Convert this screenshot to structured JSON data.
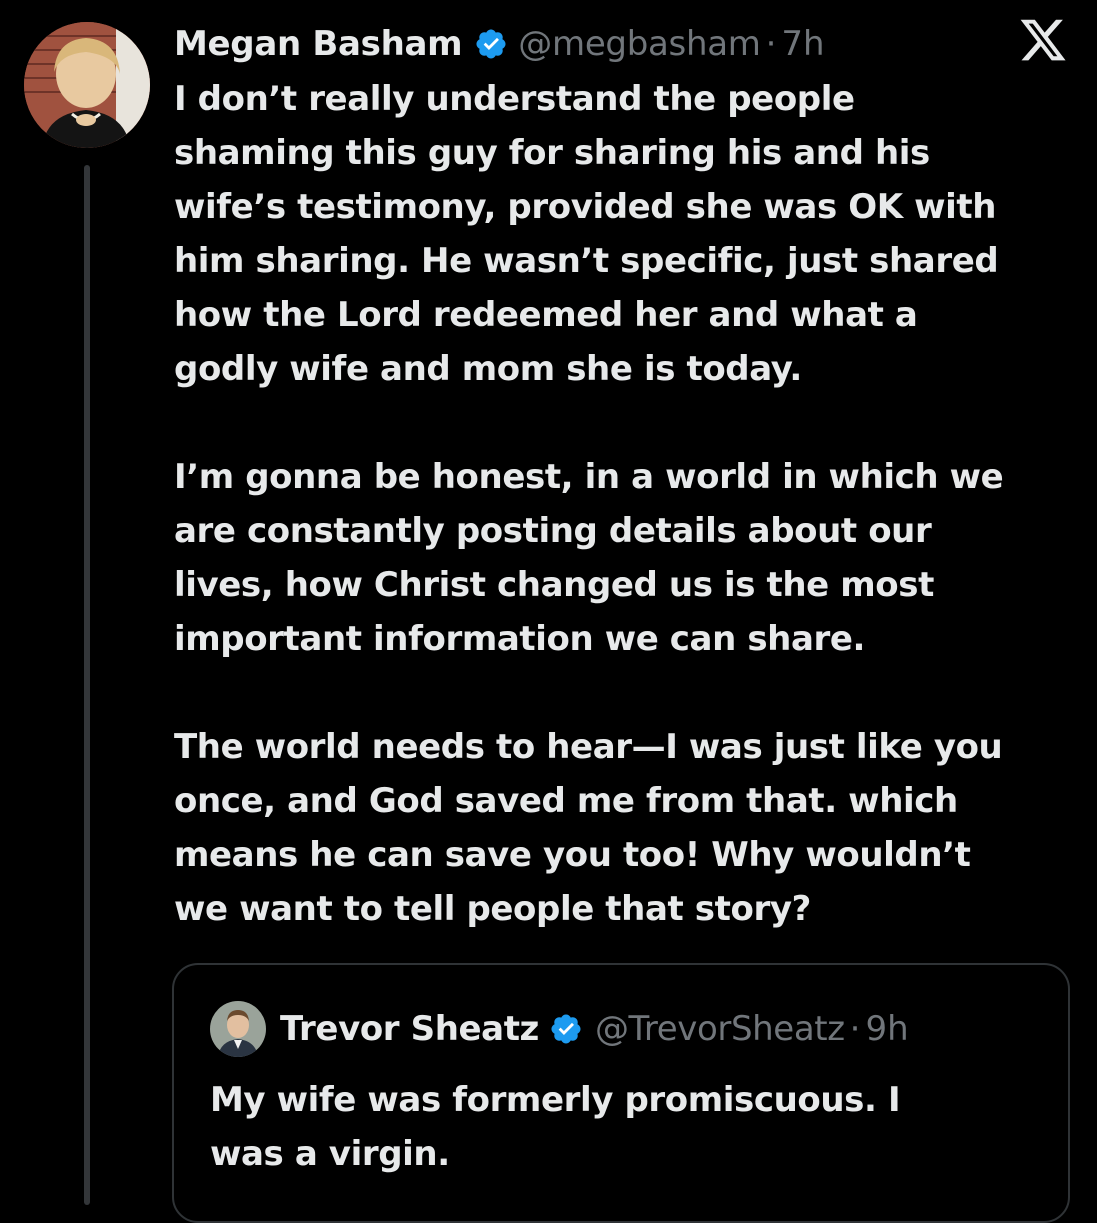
{
  "tweet": {
    "author_name": "Megan Basham",
    "handle": "@megbasham",
    "separator": "·",
    "time": "7h",
    "verified_icon": "verified-badge-icon",
    "paragraphs": [
      "I don’t really understand the people\nshaming this guy for sharing his and his\nwife’s testimony, provided she was OK with\nhim sharing. He wasn’t specific, just shared\nhow the Lord redeemed her and what a\ngodly wife and mom she is today.",
      "I’m gonna be honest, in a world in which we\nare constantly posting details about our\nlives, how Christ changed us is the most\nimportant information we can share.",
      "The world needs to hear—I was just like you\nonce, and God saved me from that. which\nmeans he can save you too! Why wouldn’t\nwe want to tell people that story?"
    ]
  },
  "quoted_tweet": {
    "author_name": "Trevor Sheatz",
    "handle": "@TrevorSheatz",
    "separator": "·",
    "time": "9h",
    "text": "My wife was formerly promiscuous. I\nwas a virgin."
  },
  "branding": {
    "logo_icon": "x-logo-icon"
  },
  "colors": {
    "background": "#000000",
    "text_primary": "#e7e9ea",
    "text_secondary": "#71767b",
    "verified_blue": "#1d9bf0",
    "border": "#2f3336"
  }
}
